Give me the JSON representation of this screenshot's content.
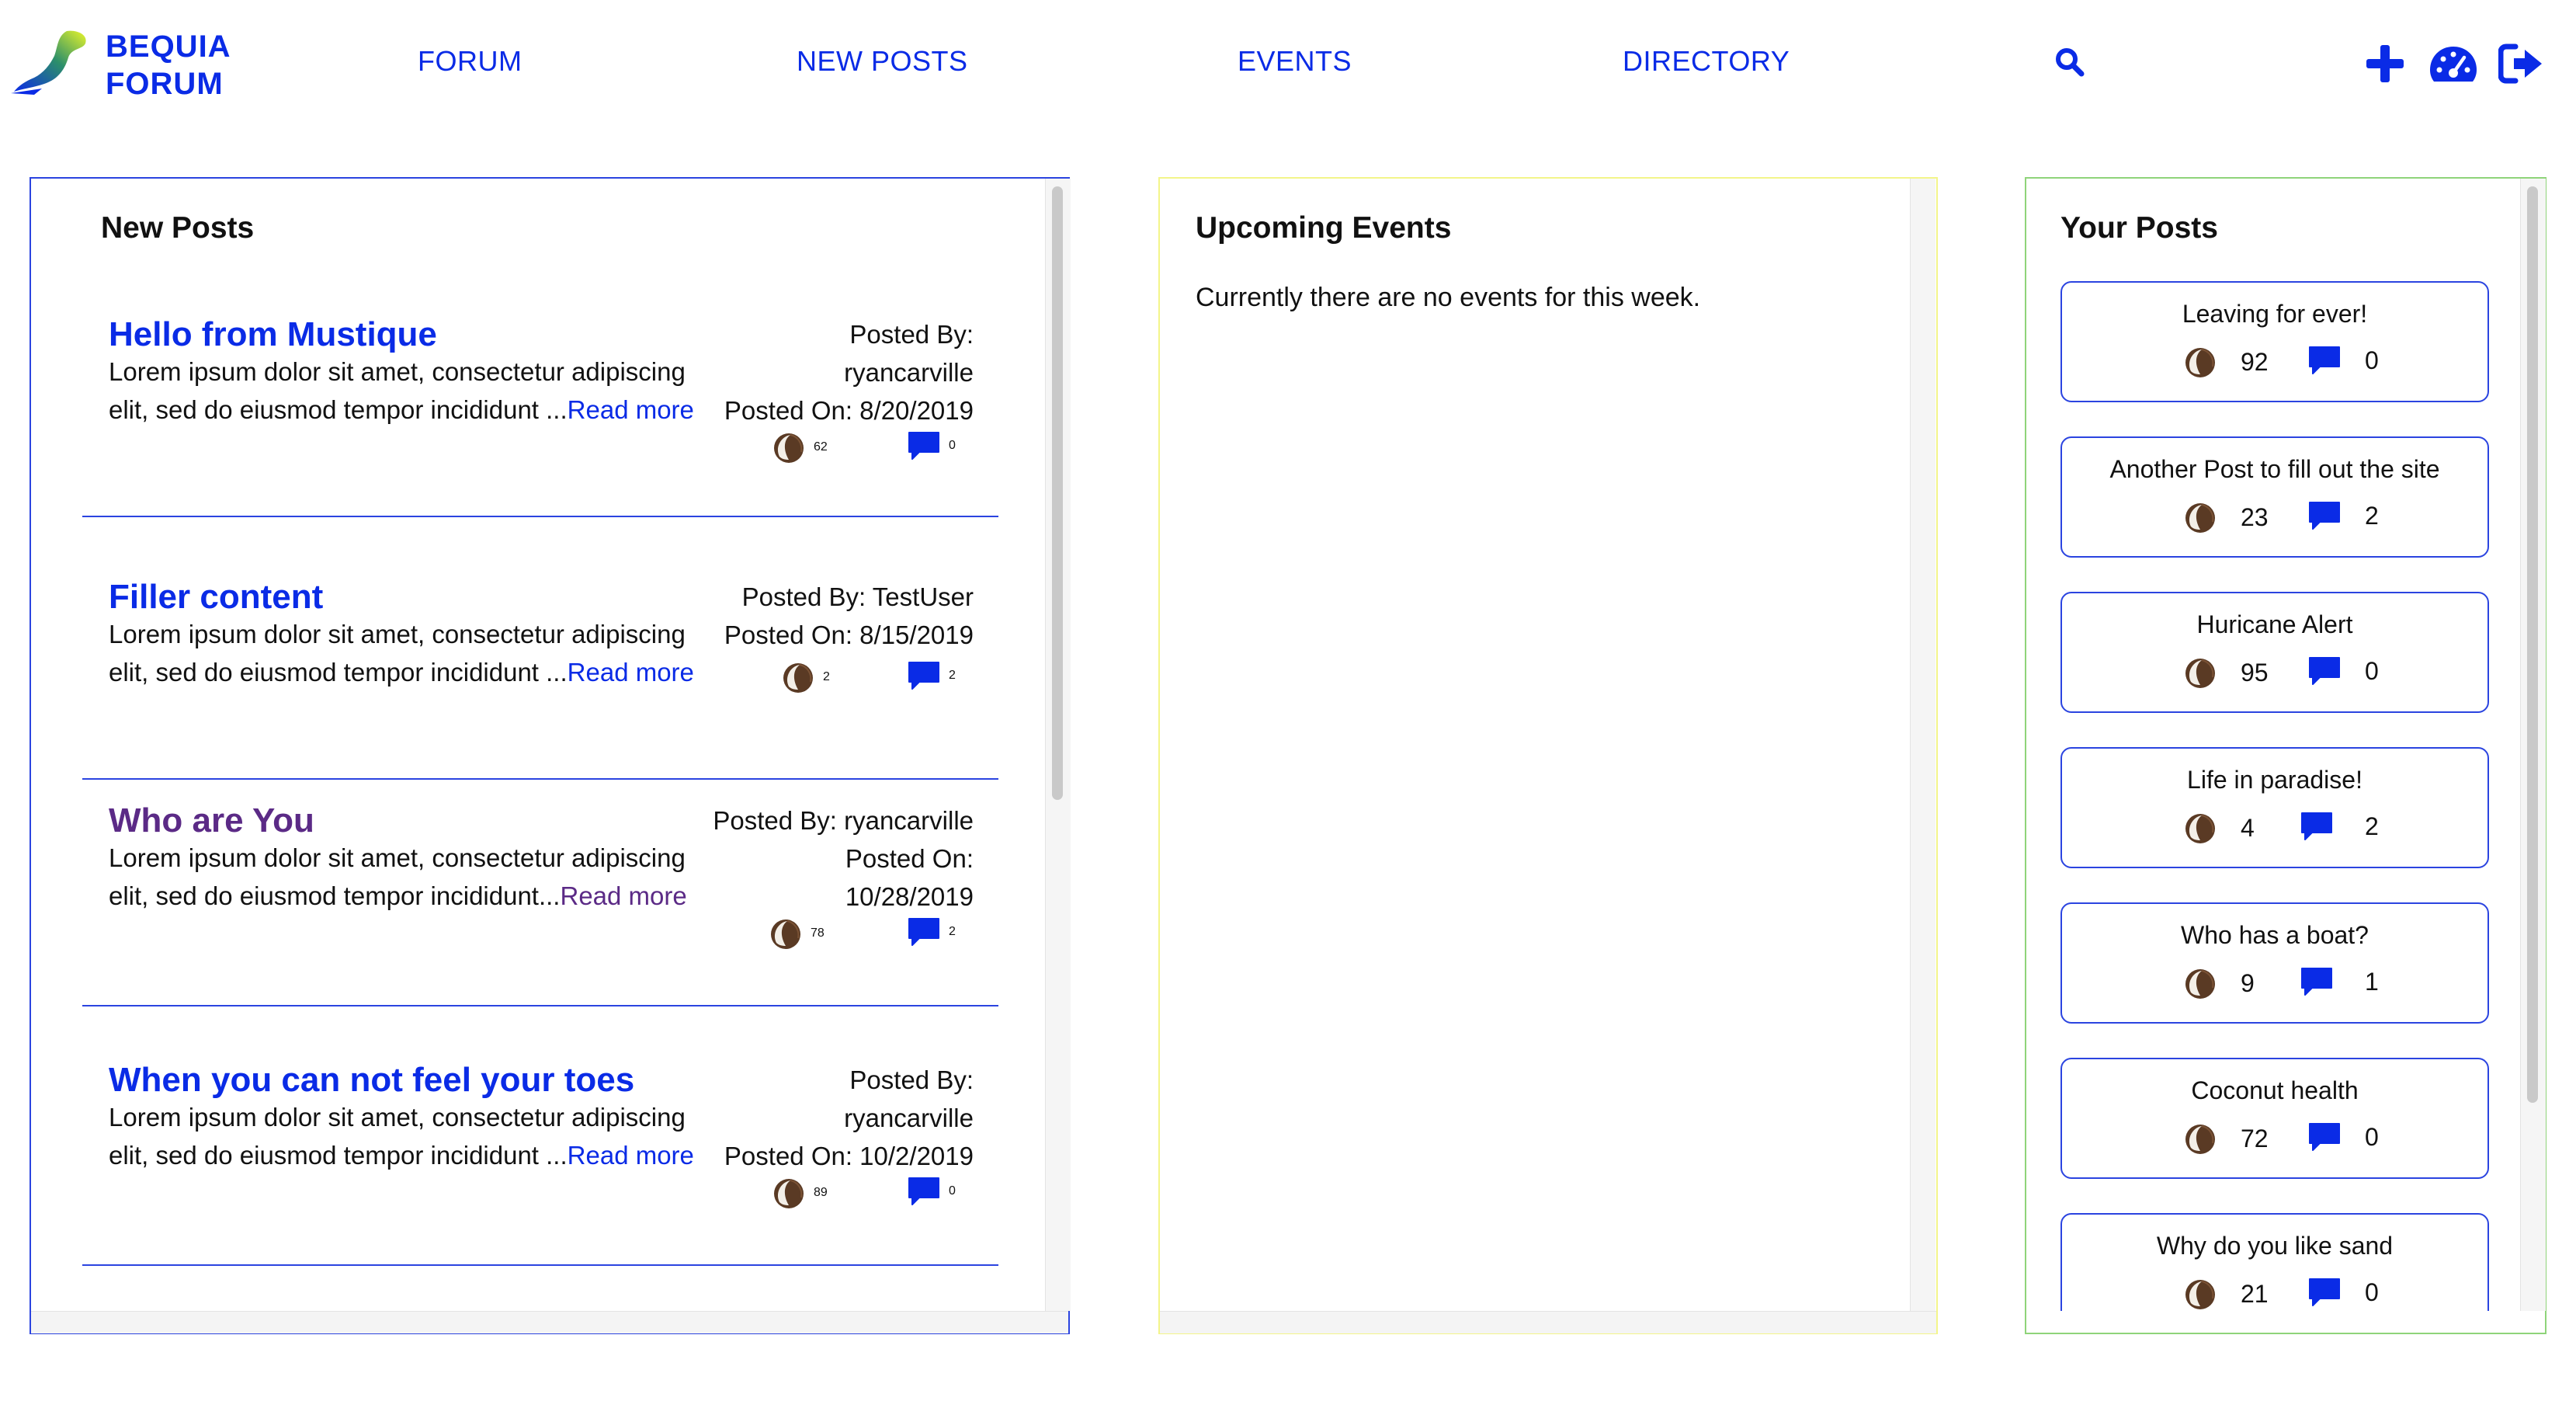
{
  "header": {
    "logo_line1": "BEQUIA",
    "logo_line2": "FORUM",
    "nav": [
      "FORUM",
      "NEW POSTS",
      "EVENTS",
      "DIRECTORY"
    ],
    "icons": [
      "search-icon",
      "plus-icon",
      "dashboard-icon",
      "logout-icon"
    ]
  },
  "new_posts": {
    "title": "New Posts",
    "read_more": "Read more",
    "items": [
      {
        "title": "Hello from Mustique",
        "excerpt": "Lorem ipsum dolor sit amet, consectetur adipiscing elit, sed do eiusmod tempor incididunt ...",
        "meta_lines": [
          "Posted By:",
          "ryancarville",
          "Posted On: 8/20/2019"
        ],
        "likes": "62",
        "comments": "0",
        "visited": false
      },
      {
        "title": "Filler content",
        "excerpt": "Lorem ipsum dolor sit amet, consectetur adipiscing elit, sed do eiusmod tempor incididunt ...",
        "meta_lines": [
          "Posted By: TestUser",
          "Posted On: 8/15/2019"
        ],
        "likes": "2",
        "comments": "2",
        "visited": false
      },
      {
        "title": "Who are You",
        "excerpt": "Lorem ipsum dolor sit amet, consectetur adipiscing elit, sed do eiusmod tempor incididunt...",
        "meta_lines": [
          "Posted By: ryancarville",
          "Posted On:",
          "10/28/2019"
        ],
        "likes": "78",
        "comments": "2",
        "visited": true
      },
      {
        "title": "When you can not feel your toes",
        "excerpt": "Lorem ipsum dolor sit amet, consectetur adipiscing elit, sed do eiusmod tempor incididunt ...",
        "meta_lines": [
          "Posted By:",
          "ryancarville",
          "Posted On: 10/2/2019"
        ],
        "likes": "89",
        "comments": "0",
        "visited": false
      }
    ]
  },
  "events": {
    "title": "Upcoming Events",
    "empty_message": "Currently there are no events for this week."
  },
  "your_posts": {
    "title": "Your Posts",
    "items": [
      {
        "title": "Leaving for ever!",
        "likes": "92",
        "comments": "0"
      },
      {
        "title": "Another Post to fill out the site",
        "likes": "23",
        "comments": "2"
      },
      {
        "title": "Huricane Alert",
        "likes": "95",
        "comments": "0"
      },
      {
        "title": "Life in paradise!",
        "likes": "4",
        "comments": "2"
      },
      {
        "title": "Who has a boat?",
        "likes": "9",
        "comments": "1"
      },
      {
        "title": "Coconut health",
        "likes": "72",
        "comments": "0"
      },
      {
        "title": "Why do you like sand",
        "likes": "21",
        "comments": "0"
      }
    ]
  },
  "colors": {
    "accent": "#0a2be6",
    "visited": "#5b2a86",
    "panel_blue": "#2b44e0",
    "panel_yellow": "#f3f58a",
    "panel_green": "#8fd47a"
  }
}
